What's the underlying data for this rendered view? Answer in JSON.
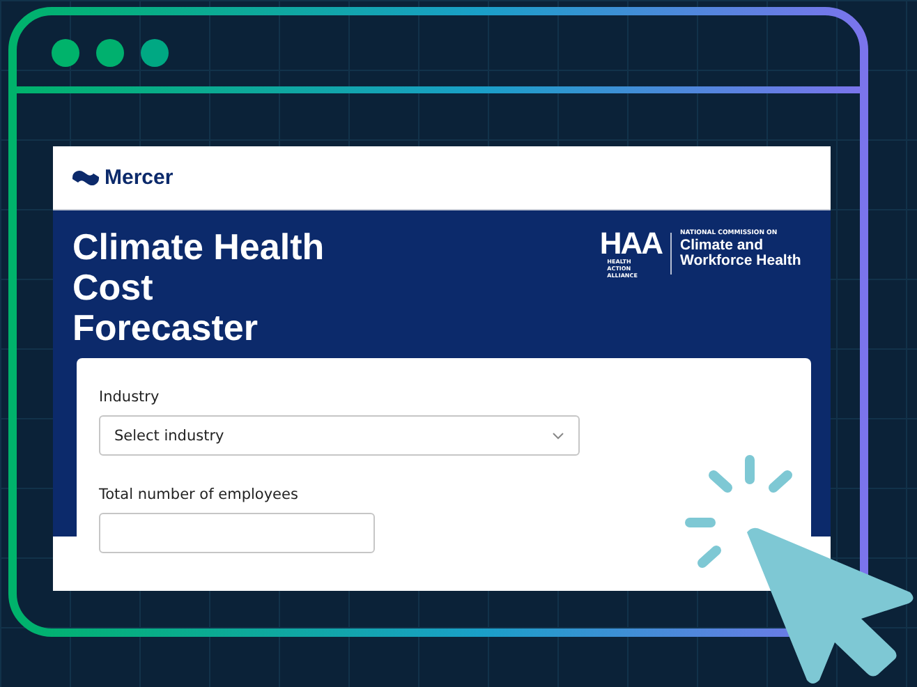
{
  "site": {
    "brand": "Mercer"
  },
  "hero": {
    "title_lines": [
      "Climate Health",
      "Cost",
      "Forecaster"
    ],
    "partner": {
      "mark": "HAA",
      "mark_caption": "HEALTH ACTION ALLIANCE",
      "kicker": "NATIONAL COMMISSION ON",
      "name": "Climate and Workforce Health"
    }
  },
  "form": {
    "fields": [
      {
        "kind": "select",
        "label": "Industry",
        "placeholder": "Select industry"
      },
      {
        "kind": "text",
        "label": "Total number of employees"
      }
    ]
  }
}
